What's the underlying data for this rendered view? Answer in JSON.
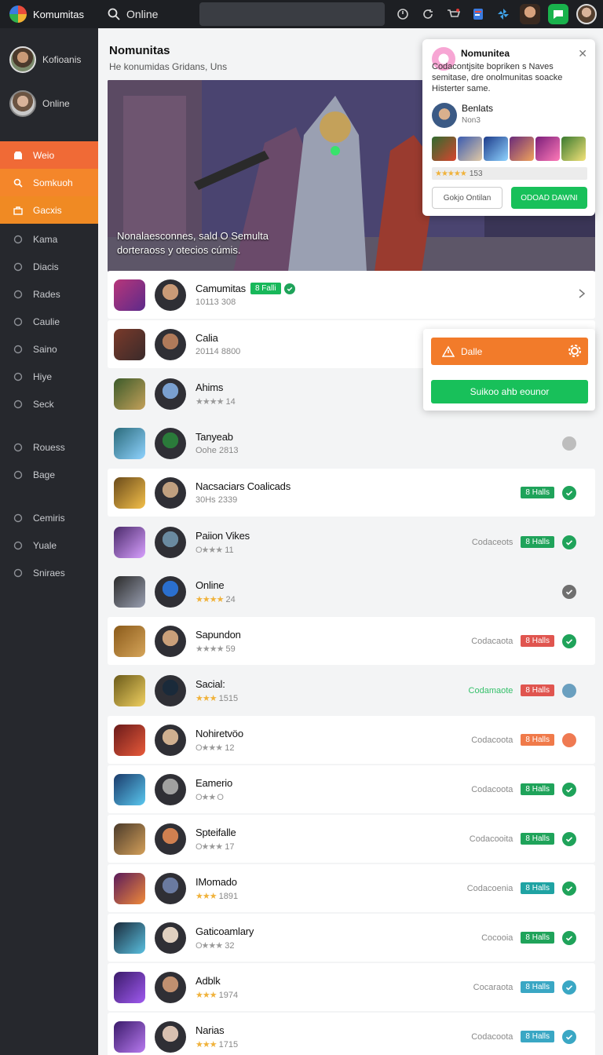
{
  "topbar": {
    "brand": "Komumitas",
    "search_label": "Online"
  },
  "sidebar": {
    "profiles": [
      {
        "name": "Kofioanis"
      },
      {
        "name": "Online"
      }
    ],
    "nav_primary": [
      {
        "label": "Weio",
        "icon": "store-icon"
      },
      {
        "label": "Somkuoh",
        "icon": "search-icon"
      },
      {
        "label": "Gacxis",
        "icon": "bag-icon"
      }
    ],
    "nav_secondary": [
      {
        "label": "Kama",
        "icon": "wand-icon"
      },
      {
        "label": "Diacis",
        "icon": "chart-icon"
      },
      {
        "label": "Rades",
        "icon": "grid-icon"
      },
      {
        "label": "Caulie",
        "icon": "circle-icon"
      },
      {
        "label": "Saino",
        "icon": "globe-icon"
      },
      {
        "label": "Hiye",
        "icon": "puzzle-icon"
      },
      {
        "label": "Seck",
        "icon": "keyboard-icon"
      }
    ],
    "nav_tertiary": [
      {
        "label": "Rouess",
        "icon": "disc-icon"
      },
      {
        "label": "Bage",
        "icon": "gift-icon"
      }
    ],
    "nav_bottom": [
      {
        "label": "Cemiris",
        "icon": "search-icon"
      },
      {
        "label": "Yuale",
        "icon": "plus-icon"
      },
      {
        "label": "Sniraes",
        "icon": "face-icon"
      }
    ]
  },
  "main": {
    "title": "Nomunitas",
    "subtitle": "He konumidas Gridans, Uns",
    "hero_text": "Nonalaesconnes, sald O Semulta dorteraoss y otecios cúmis."
  },
  "popup": {
    "title": "Nomunitea",
    "description": "Codacontjsite bopriken s Naves semitase, dre onolmunitas soacke Histerter same.",
    "user_name": "Benlats",
    "user_sub": "Non3",
    "rating_count": "153",
    "rating_stars": "★★★★★",
    "btn_secondary": "Gokjo Ontilan",
    "btn_primary": "ODOAD DAWNI"
  },
  "action_card": {
    "orange_label": "Dalle",
    "green_label": "Suikoo ahb eounor"
  },
  "list": [
    {
      "name": "Camumitas",
      "sub": "10113 308",
      "stars": "",
      "pill": "8 Falli",
      "pill_color": "#18b85a",
      "check": true,
      "status": "",
      "chevron": true,
      "dot": ""
    },
    {
      "name": "Calia",
      "sub": "20114 8800",
      "stars": "",
      "pill": "",
      "dot": "",
      "status": ""
    },
    {
      "name": "Ahims",
      "sub": "14",
      "stars": "★★★★",
      "stars_grey": true,
      "pill": "",
      "dot": "",
      "status": ""
    },
    {
      "name": "Tanyeab",
      "sub": "Oohe 2813",
      "stars": "",
      "pill": "",
      "dot": "#bdbdbd",
      "status": ""
    },
    {
      "name": "Nacsaciars Coalicads",
      "sub": "30Hs 2339",
      "stars": "",
      "pill": "8 Halls",
      "pill_color": "#1fa35a",
      "dot": "check-green",
      "status": ""
    },
    {
      "name": "Paiion Vikes",
      "sub": "11",
      "stars": "O★★★",
      "stars_grey": true,
      "pill": "8 Halls",
      "pill_color": "#1fa35a",
      "dot": "check-green",
      "status": "Codaceots"
    },
    {
      "name": "Online",
      "sub": "24",
      "stars": "★★★★",
      "pill": "",
      "dot": "check-grey",
      "status": ""
    },
    {
      "name": "Sapundon",
      "sub": "59",
      "stars": "★★★★",
      "stars_grey": true,
      "pill": "8 Halls",
      "pill_color": "#e0554f",
      "dot": "check-green",
      "status": "Codacaota"
    },
    {
      "name": "Sacial: ",
      "sub": "1515",
      "stars": "★★★",
      "pill": "8 Halls",
      "pill_color": "#e0554f",
      "dot": "#6a9fbf",
      "status": "Codamaote",
      "status_color": "#35c06a"
    },
    {
      "name": "Nohiretvöo",
      "sub": "12",
      "stars": "O★★★",
      "stars_grey": true,
      "pill": "8 Halls",
      "pill_color": "#f07a4a",
      "dot": "#ef7a52",
      "status": "Codacoota"
    },
    {
      "name": "Eamerio",
      "sub": "",
      "stars": "O★★ O",
      "stars_grey": true,
      "pill": "8 Halls",
      "pill_color": "#1fa35a",
      "dot": "check-green",
      "status": "Codacoota"
    },
    {
      "name": "Spteifalle",
      "sub": "17",
      "stars": "O★★★",
      "stars_grey": true,
      "pill": "8 Halls",
      "pill_color": "#1fa35a",
      "dot": "check-green",
      "status": "Codacooita"
    },
    {
      "name": "IMomado",
      "sub": "1891",
      "stars": "★★★",
      "pill": "8 Halls",
      "pill_color": "#1fa3a3",
      "dot": "check-green",
      "status": "Codacoenia"
    },
    {
      "name": "Gaticoamlary",
      "sub": "32",
      "stars": "O★★★",
      "stars_grey": true,
      "pill": "8 Halls",
      "pill_color": "#1fa35a",
      "dot": "check-green",
      "status": "Cocooia"
    },
    {
      "name": "Adblk",
      "sub": "1974",
      "stars": "★★★",
      "pill": "8 Halls",
      "pill_color": "#3aa7c4",
      "dot": "check-teal",
      "status": "Cocaraota"
    },
    {
      "name": "Narias",
      "sub": "1715",
      "stars": "★★★",
      "pill": "8 Halls",
      "pill_color": "#3aa7c4",
      "dot": "check-teal",
      "status": "Codacoota"
    }
  ],
  "colors": {
    "accent_orange": "#f27b2a",
    "accent_green": "#18c05a",
    "sidebar_bg": "#26282d",
    "topbar_bg": "#1d1f23"
  }
}
